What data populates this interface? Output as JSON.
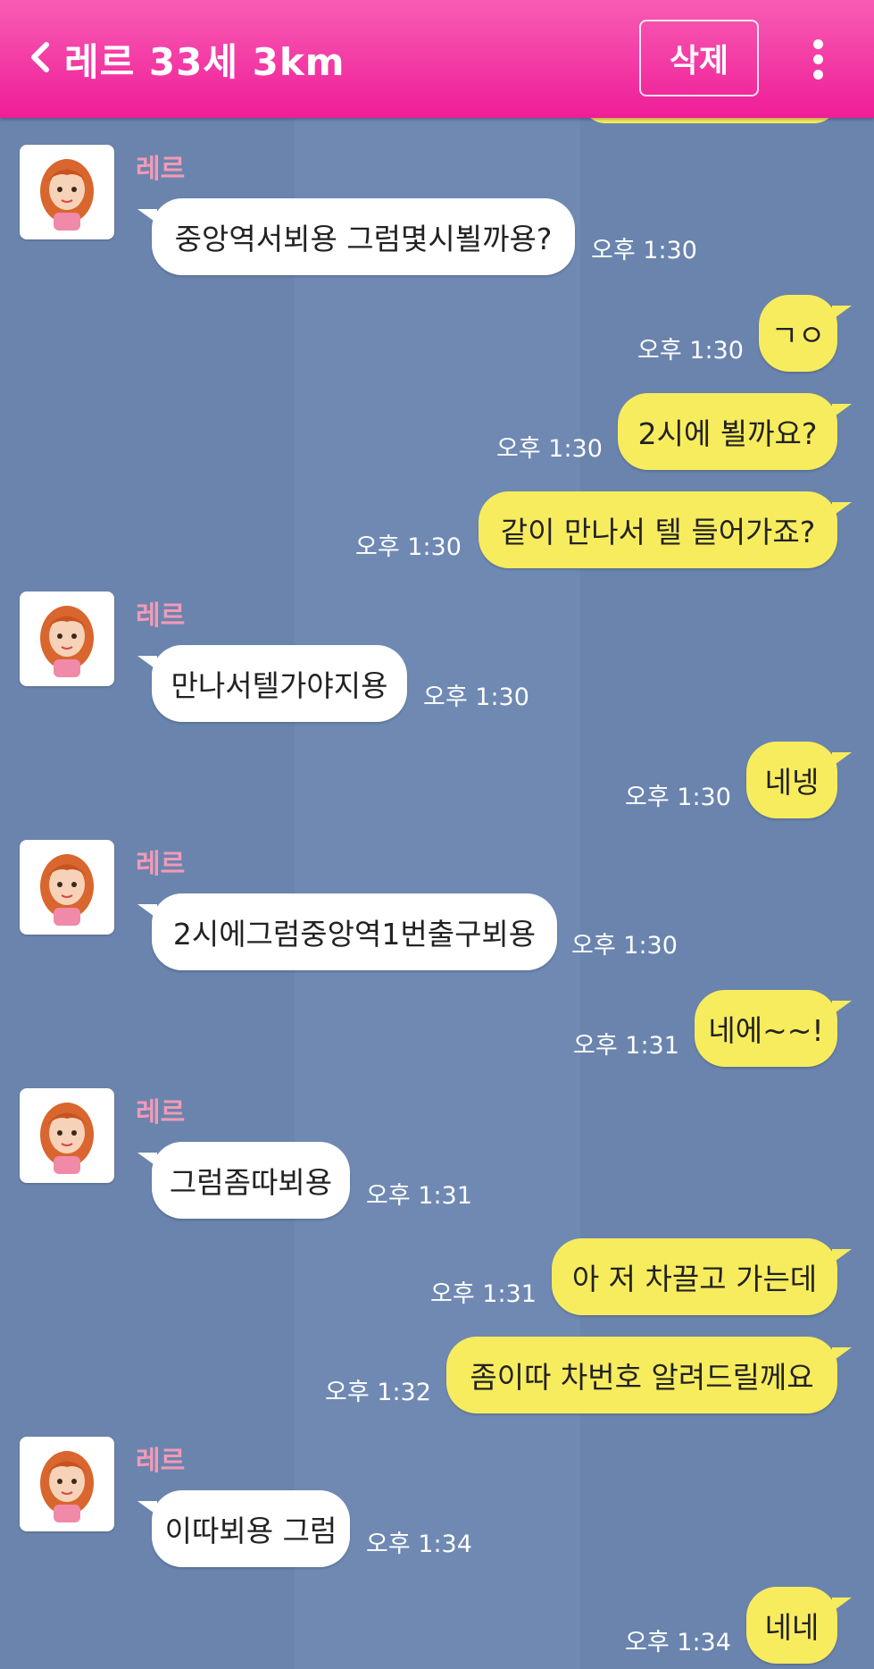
{
  "header": {
    "title": "레르 33세 3km",
    "delete_label": "삭제"
  },
  "messages": [
    {
      "type": "in",
      "sender": "레르",
      "text": "중앙역서뵈용 그럼몇시뵐까용?",
      "time": "오후 1:30"
    },
    {
      "type": "out",
      "text": "ㄱㅇ",
      "time": "오후 1:30"
    },
    {
      "type": "out",
      "text": "2시에 뵐까요?",
      "time": "오후 1:30"
    },
    {
      "type": "out",
      "text": "같이 만나서 텔 들어가죠?",
      "time": "오후 1:30"
    },
    {
      "type": "in",
      "sender": "레르",
      "text": "만나서텔가야지용",
      "time": "오후 1:30"
    },
    {
      "type": "out",
      "text": "네넹",
      "time": "오후 1:30"
    },
    {
      "type": "in",
      "sender": "레르",
      "text": "2시에그럼중앙역1번출구뵈용",
      "time": "오후 1:30"
    },
    {
      "type": "out",
      "text": "네에~~!",
      "time": "오후 1:31"
    },
    {
      "type": "in",
      "sender": "레르",
      "text": "그럼좀따뵈용",
      "time": "오후 1:31"
    },
    {
      "type": "out",
      "text": "아 저 차끌고 가는데",
      "time": "오후 1:31"
    },
    {
      "type": "out",
      "text": "좀이따 차번호 알려드릴께요",
      "time": "오후 1:32"
    },
    {
      "type": "in",
      "sender": "레르",
      "text": "이따뵈용 그럼",
      "time": "오후 1:34"
    },
    {
      "type": "out",
      "text": "네네",
      "time": "오후 1:34"
    }
  ]
}
